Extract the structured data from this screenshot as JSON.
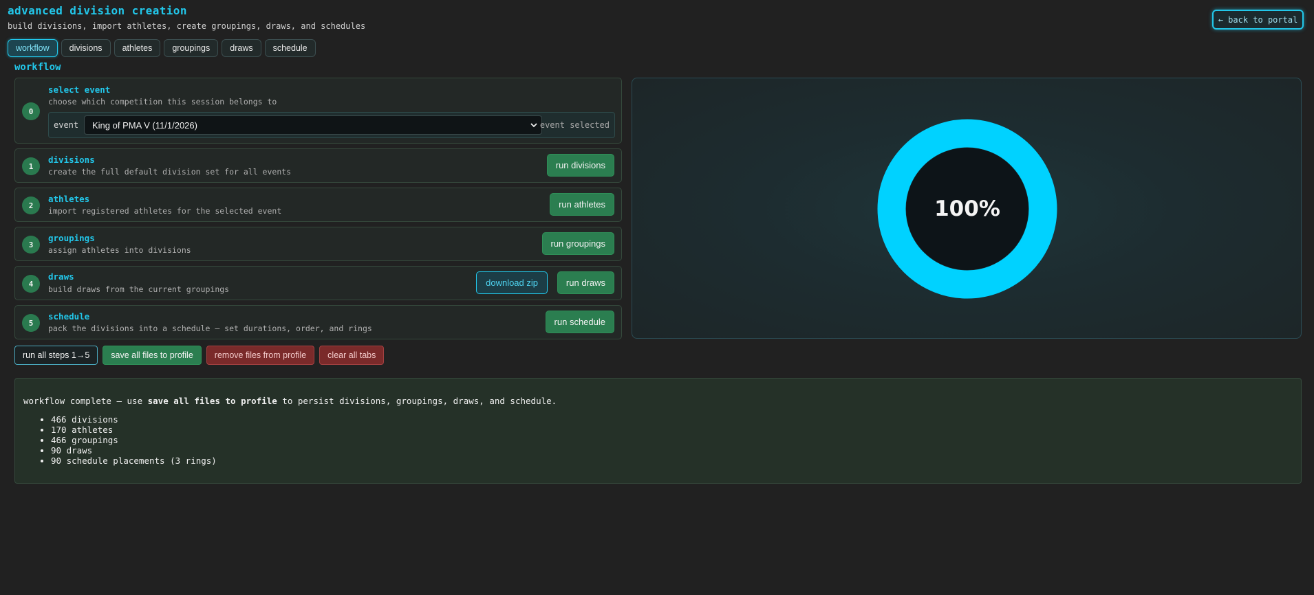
{
  "header": {
    "title": "advanced division creation",
    "subtitle": "build divisions, import athletes, create groupings, draws, and schedules",
    "back_label": "← back to portal"
  },
  "tabs": [
    {
      "label": "workflow",
      "active": true
    },
    {
      "label": "divisions",
      "active": false
    },
    {
      "label": "athletes",
      "active": false
    },
    {
      "label": "groupings",
      "active": false
    },
    {
      "label": "draws",
      "active": false
    },
    {
      "label": "schedule",
      "active": false
    }
  ],
  "section_title": "workflow",
  "steps": [
    {
      "num": "0",
      "title": "select event",
      "desc": "choose which competition this session belongs to",
      "event_label": "event",
      "event_value": "King of PMA V (11/1/2026)",
      "event_status": "event selected"
    },
    {
      "num": "1",
      "title": "divisions",
      "desc": "create the full default division set for all events",
      "button": "run divisions"
    },
    {
      "num": "2",
      "title": "athletes",
      "desc": "import registered athletes for the selected event",
      "button": "run athletes"
    },
    {
      "num": "3",
      "title": "groupings",
      "desc": "assign athletes into divisions",
      "button": "run groupings"
    },
    {
      "num": "4",
      "title": "draws",
      "desc": "build draws from the current groupings",
      "button": "run draws",
      "zip_button": "download zip"
    },
    {
      "num": "5",
      "title": "schedule",
      "desc": "pack the divisions into a schedule — set durations, order, and rings",
      "button": "run schedule"
    }
  ],
  "actions": {
    "run_all": "run all steps 1→5",
    "save_all": "save all files to profile",
    "remove": "remove files from profile",
    "clear": "clear all tabs"
  },
  "progress": {
    "percent_label": "100%",
    "fraction": 1.0,
    "color": "#00d2ff"
  },
  "result": {
    "msg_pre": "workflow complete — use ",
    "msg_bold": "save all files to profile",
    "msg_post": " to persist divisions, groupings, draws, and schedule.",
    "items": [
      "466 divisions",
      "170 athletes",
      "466 groupings",
      "90 draws",
      "90 schedule placements (3 rings)"
    ]
  }
}
